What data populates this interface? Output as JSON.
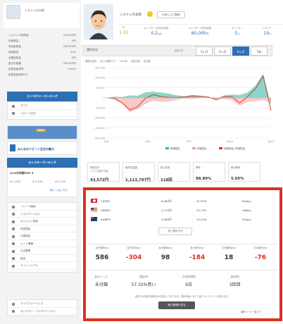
{
  "trader": {
    "name": "シストレの太郎",
    "follow_button": "お気に入り登録"
  },
  "left_stats": [
    {
      "label": "シストレ口座残高",
      "value": "769,876円"
    },
    {
      "label": "評価損益",
      "value": "0円"
    },
    {
      "label": "有効証拠金",
      "value": "769,876円"
    },
    {
      "label": "保有数量",
      "value": "0Lot"
    },
    {
      "label": "必要証拠金",
      "value": "0円"
    },
    {
      "label": "建玉可能額",
      "value": "769,876円"
    },
    {
      "label": "証拠金維持率",
      "value": "0.00%"
    },
    {
      "label": "証拠金維持率(%)",
      "value": "-"
    }
  ],
  "ranking_band": "ストラテジーランキング",
  "ranking_links": [
    "すべて",
    "リピート注文"
  ],
  "new_label": "NEW",
  "banner_text": "みんなのリピート注文の魅力",
  "selector_band": "セレクターランキング",
  "selector_top": "11/1の年間TOP 3",
  "selector_items": [
    "★ 2,578",
    "★ 2,378",
    "★ 2,176"
  ],
  "selector_more": "詳しくはこちら",
  "menu_items": [
    "トレード画面",
    "フォロワーリスト",
    "ポジション照会",
    "約定照会",
    "口座照会",
    "レート情報",
    "注文履歴",
    "設定",
    "チュートリアル"
  ],
  "bottom_links": [
    "マイパフォーマンス",
    "セレクター・フォロワーリスト"
  ],
  "header_stats": [
    {
      "label": "PF",
      "value": "1.62"
    },
    {
      "label": "セレクターの投資可能量",
      "value": "0.2",
      "unit": "Lot"
    },
    {
      "label": "セレクターの投資金額",
      "value": "80,000",
      "unit": "円"
    },
    {
      "label": "セレクター",
      "value": "5",
      "unit": "人"
    },
    {
      "label": "フォロワー",
      "value": "19",
      "unit": "人"
    }
  ],
  "tabs": [
    "運用状況",
    "1ヶ月",
    "3ヶ月",
    "6ヶ月",
    "1年"
  ],
  "tab_prefix": "過去1年",
  "chart_legend_note": "期間を選択 ・ 全ての通貨ペア ・ 2015年 ・ 損益計算 ・ 建玉数",
  "chart_data": {
    "type": "line",
    "x_labels": [
      "16/1",
      "16/4",
      "16/7",
      "16/10",
      "16/12"
    ],
    "y_ticks": [
      "150,000",
      "100,000",
      "50,000",
      "0",
      "-50,000",
      "-100,000",
      "-150,000",
      "-200,000"
    ],
    "series": [
      {
        "name": "実現損益",
        "color": "#2bb5a0",
        "values": [
          0,
          6000,
          4000,
          12000,
          10000,
          28000,
          30000,
          26000,
          20000,
          12000,
          8000,
          15000,
          10000,
          4000,
          -6000,
          12000,
          16000,
          14000,
          26000,
          60000,
          120000,
          -40000
        ]
      },
      {
        "name": "評価損益",
        "color": "#f59a9a",
        "values": [
          0,
          -8000,
          -28000,
          -72000,
          -56000,
          -30000,
          -14000,
          -20000,
          -18000,
          -10000,
          -4000,
          -6000,
          -2000,
          0,
          -4000,
          -6000,
          -10000,
          -40000,
          -20000,
          -16000,
          -12000,
          -24000
        ]
      },
      {
        "name": "損益",
        "color": "#e0301e",
        "values": [
          0,
          -2000,
          -24000,
          -60000,
          -44000,
          -2000,
          16000,
          6000,
          2000,
          2000,
          4000,
          9000,
          8000,
          4000,
          -10000,
          6000,
          6000,
          -26000,
          6000,
          44000,
          108000,
          -64000
        ]
      }
    ],
    "legend": [
      "実現損益",
      "評価損益",
      "評価損益+評価損益"
    ],
    "ylim": [
      -200000,
      150000
    ]
  },
  "metric_cards": [
    {
      "label": "獲得合計\n(コスト差引き後)",
      "value": "43,572円"
    },
    {
      "label": "最終損益額",
      "value": "1,113,797円"
    },
    {
      "label": "取引回数",
      "value": "118回"
    },
    {
      "label": "勝率",
      "value": "88.89%"
    },
    {
      "label": "最大勝率",
      "value": "5.05%"
    }
  ],
  "pairs": [
    {
      "flag": "ch",
      "name": "CHFJPY",
      "amount": "8,084円",
      "pct": "31.92%",
      "pips": "87pips"
    },
    {
      "flag": "us",
      "name": "USDJPY",
      "amount": "2,170円",
      "pct": "15.73%",
      "pips": "16pips"
    },
    {
      "flag": "au",
      "name": "AUDJPY",
      "amount": "4,980円",
      "pct": "10.54%",
      "pips": "52pips"
    }
  ],
  "show_all": "全て表示する",
  "stat_cells": [
    {
      "label": "合計獲得pips",
      "value": "586",
      "neg": false
    },
    {
      "label": "合計損失pips",
      "value": "-304",
      "neg": true
    },
    {
      "label": "最大獲得pips",
      "value": "98",
      "neg": false
    },
    {
      "label": "最大損失pips",
      "value": "-184",
      "neg": true
    },
    {
      "label": "平均獲得pips",
      "value": "18",
      "neg": false
    },
    {
      "label": "平均損失pips",
      "value": "-76",
      "neg": true
    }
  ],
  "info_cells": [
    {
      "label": "最大ストック",
      "value": "未分類"
    },
    {
      "label": "買建比率",
      "value": "57.32%買い"
    },
    {
      "label": "平均保有期間",
      "value": "6日"
    },
    {
      "label": "最終損失",
      "value": "5回目"
    }
  ],
  "notice": "過去1年の取引記録のみを表示しております。集計対象: FXピリ建てストラテジーを除きます。",
  "follow_now": "取引履歴を見る",
  "bottom_right": "最終ルール一覧です"
}
